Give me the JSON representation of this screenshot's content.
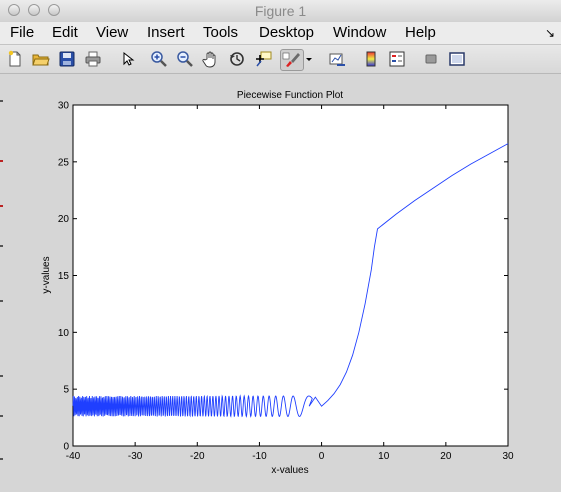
{
  "window": {
    "title": "Figure 1"
  },
  "menu": {
    "items": [
      "File",
      "Edit",
      "View",
      "Insert",
      "Tools",
      "Desktop",
      "Window",
      "Help"
    ]
  },
  "toolbar": {
    "icons": [
      "new-figure-icon",
      "open-file-icon",
      "save-icon",
      "print-icon",
      "edit-plot-arrow-icon",
      "zoom-in-icon",
      "zoom-out-icon",
      "pan-hand-icon",
      "rotate-3d-icon",
      "data-cursor-icon",
      "brush-icon",
      "brush-dropdown-icon",
      "link-plot-icon",
      "insert-colorbar-icon",
      "insert-legend-icon",
      "hide-plot-tools-icon",
      "show-plot-tools-icon"
    ]
  },
  "chart_data": {
    "type": "line",
    "title": "Piecewise Function Plot",
    "xlabel": "x-values",
    "ylabel": "y-values",
    "xlim": [
      -40,
      30
    ],
    "ylim": [
      0,
      30
    ],
    "xticks": [
      -40,
      -30,
      -20,
      -10,
      0,
      10,
      20,
      30
    ],
    "yticks": [
      0,
      5,
      10,
      15,
      20,
      25,
      30
    ],
    "grid": false,
    "line_color": "#1f3fff",
    "segments": [
      {
        "domain": [
          -40,
          0
        ],
        "description_points": {
          "x": [
            -40,
            -30,
            -20,
            -10,
            -2,
            -1,
            0
          ],
          "y": [
            3.5,
            3.5,
            3.5,
            3.5,
            3.5,
            4.3,
            3.5
          ]
        },
        "oscillation_band": [
          2.6,
          4.4
        ]
      },
      {
        "domain": [
          0,
          9
        ],
        "points": {
          "x": [
            0,
            1,
            2,
            3,
            4,
            5,
            6,
            7,
            8,
            8.5,
            9
          ],
          "y": [
            3.5,
            4.0,
            4.6,
            5.4,
            6.5,
            8.0,
            10.0,
            12.5,
            15.5,
            17.5,
            19.1
          ]
        }
      },
      {
        "domain": [
          9,
          30
        ],
        "points": {
          "x": [
            9,
            12,
            15,
            18,
            21,
            24,
            27,
            30
          ],
          "y": [
            19.1,
            20.4,
            21.6,
            22.7,
            23.8,
            24.8,
            25.7,
            26.6
          ]
        }
      }
    ]
  }
}
